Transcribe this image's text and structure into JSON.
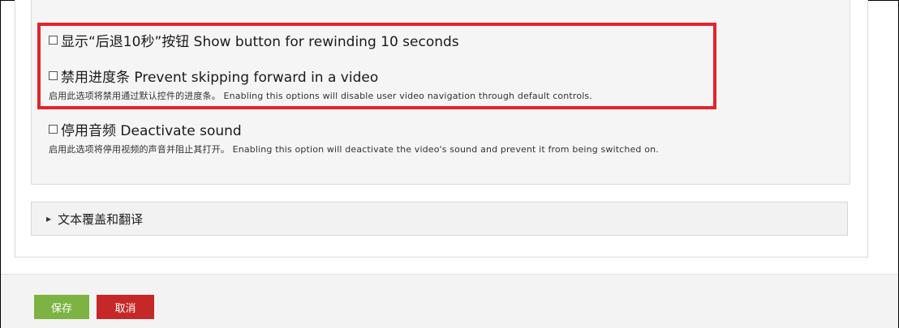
{
  "options": [
    {
      "label": "显示“后退10秒”按钮 Show button for rewinding 10 seconds",
      "checked": false
    },
    {
      "label": "禁用进度条 Prevent skipping forward in a video",
      "help": "启用此选项将禁用通过默认控件的进度条。 Enabling this options will disable user video navigation through default controls.",
      "checked": false
    },
    {
      "label": "停用音频 Deactivate sound",
      "help": "启用此选项将停用视频的声音并阻止其打开。 Enabling this option will deactivate the video's sound and prevent it from being switched on.",
      "checked": false
    }
  ],
  "collapsible": {
    "title": "文本覆盖和翻译",
    "expanded": false
  },
  "buttons": {
    "save": "保存",
    "cancel": "取消"
  },
  "colors": {
    "highlight": "#e3242b",
    "save": "#7cb342",
    "cancel": "#c62828"
  }
}
